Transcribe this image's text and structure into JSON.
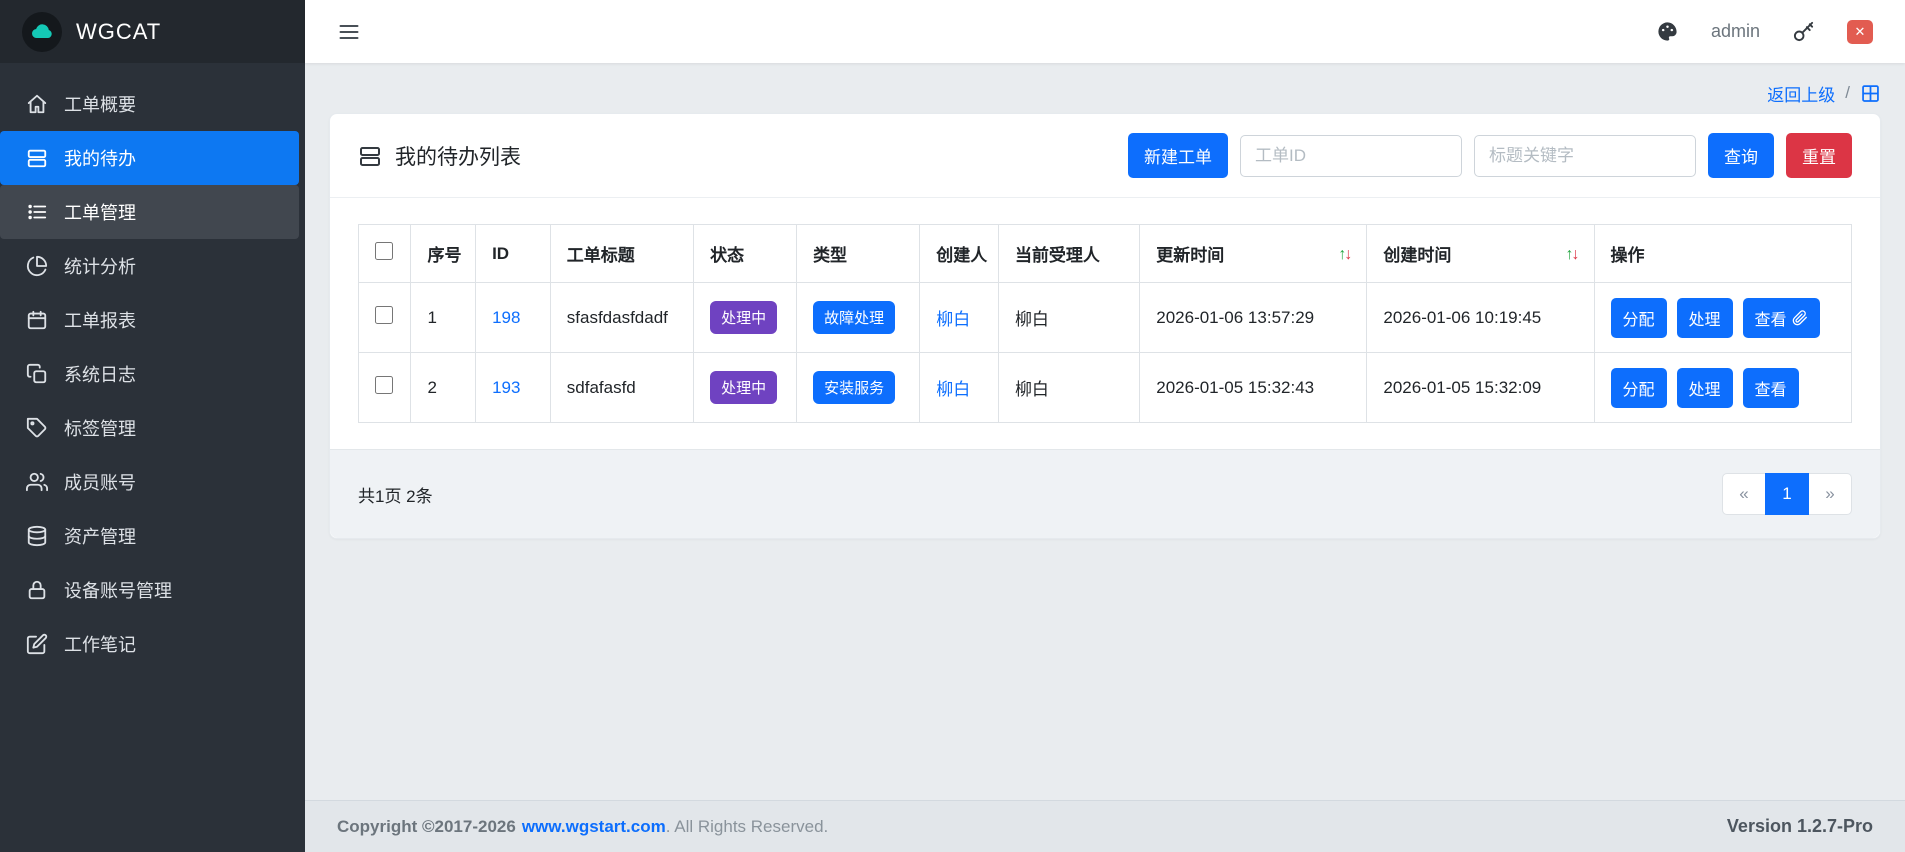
{
  "app": {
    "logo": "WGCAT"
  },
  "topbar": {
    "username": "admin"
  },
  "icons": {
    "logout": "✕"
  },
  "colors": {
    "primary": "#0d6efd",
    "sidebar_active": "#0d78f2",
    "danger": "#dc3545",
    "status_badge": "#6f42c1",
    "type_badge": "#0d6efd",
    "sidebar_bg": "#2b3139",
    "logo_cloud": "#14c9b6"
  },
  "sidebar": {
    "items": [
      {
        "key": "overview",
        "icon": "home",
        "label": "工单概要"
      },
      {
        "key": "my-todo",
        "icon": "cards",
        "label": "我的待办",
        "active": true
      },
      {
        "key": "order-manage",
        "icon": "list",
        "label": "工单管理",
        "secondary": true
      },
      {
        "key": "stats",
        "icon": "pie",
        "label": "统计分析"
      },
      {
        "key": "order-report",
        "icon": "calendar",
        "label": "工单报表"
      },
      {
        "key": "system-log",
        "icon": "copy",
        "label": "系统日志"
      },
      {
        "key": "tag-manage",
        "icon": "tag",
        "label": "标签管理"
      },
      {
        "key": "members",
        "icon": "users",
        "label": "成员账号"
      },
      {
        "key": "assets",
        "icon": "database",
        "label": "资产管理"
      },
      {
        "key": "device-accounts",
        "icon": "lock",
        "label": "设备账号管理"
      },
      {
        "key": "work-notes",
        "icon": "edit",
        "label": "工作笔记"
      }
    ]
  },
  "breadcrumb": {
    "back": "返回上级",
    "separator": "/"
  },
  "panel": {
    "title": "我的待办列表",
    "new_order": "新建工单",
    "order_id_placeholder": "工单ID",
    "keyword_placeholder": "标题关键字",
    "query": "查询",
    "reset": "重置"
  },
  "table": {
    "headers": [
      "序号",
      "ID",
      "工单标题",
      "状态",
      "类型",
      "创建人",
      "当前受理人",
      "更新时间",
      "创建时间",
      "操作"
    ],
    "sort_up": "↑",
    "sort_down": "↓",
    "rows": [
      {
        "seq": "1",
        "id": "198",
        "title": "sfasfdasfdadf",
        "status": "处理中",
        "type": "故障处理",
        "creator": "柳白",
        "handler": "柳白",
        "updated": "2026-01-06 13:57:29",
        "created": "2026-01-06 10:19:45",
        "actions": [
          {
            "key": "assign",
            "label": "分配"
          },
          {
            "key": "handle",
            "label": "处理"
          },
          {
            "key": "view",
            "label": "查看",
            "attachment": true
          }
        ]
      },
      {
        "seq": "2",
        "id": "193",
        "title": "sdfafasfd",
        "status": "处理中",
        "type": "安装服务",
        "creator": "柳白",
        "handler": "柳白",
        "updated": "2026-01-05 15:32:43",
        "created": "2026-01-05 15:32:09",
        "actions": [
          {
            "key": "assign",
            "label": "分配"
          },
          {
            "key": "handle",
            "label": "处理"
          },
          {
            "key": "view",
            "label": "查看"
          }
        ]
      }
    ]
  },
  "pagination": {
    "summary": "共1页 2条",
    "prev": "«",
    "page": "1",
    "next": "»"
  },
  "footer": {
    "bold": "Copyright ©2017-2026",
    "link": "www.wgstart.com",
    "rest": ". All Rights Reserved.",
    "version": "Version 1.2.7-Pro"
  }
}
